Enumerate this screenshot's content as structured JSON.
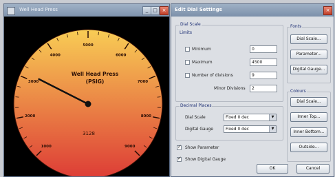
{
  "gauge_window": {
    "title": "Well Head Press",
    "minimize_glyph": "_",
    "maximize_glyph": "□",
    "close_glyph": "×"
  },
  "gauge": {
    "title_line1": "Well Head Press",
    "title_line2": "(PSIG)",
    "digital_value": "3128",
    "scale_labels": [
      "1000",
      "2000",
      "3000",
      "4000",
      "5000",
      "6000",
      "7000",
      "8000",
      "9000"
    ],
    "needle_value": 3128,
    "gradient_top": "#f8cd55",
    "gradient_bottom": "#dd3c36"
  },
  "dialog": {
    "title": "Edit Dial Settings",
    "close_glyph": "×",
    "dial_scale_group": {
      "legend": "Dial Scale",
      "sublegend": "Limits",
      "minimum_label": "Minimum",
      "minimum_value": "0",
      "maximum_label": "Maximum",
      "maximum_value": "4500",
      "num_divisions_label": "Number of divisions",
      "num_divisions_value": "9",
      "minor_divisions_label": "Minor Divisions",
      "minor_divisions_value": "2"
    },
    "decimal_group": {
      "legend": "Decimal Places",
      "dial_scale_label": "Dial Scale",
      "dial_scale_value": "Fixed 0 dec",
      "digital_gauge_label": "Digital Gauge",
      "digital_gauge_value": "Fixed 0 dec"
    },
    "show_parameter_label": "Show Parameter",
    "show_digital_gauge_label": "Show Digital Gauge",
    "fonts_group": {
      "legend": "Fonts",
      "buttons": [
        "Dial Scale...",
        "Parameter...",
        "Digital Gauge..."
      ]
    },
    "colours_group": {
      "legend": "Colours",
      "buttons": [
        "Dial Scale...",
        "Inner Top...",
        "Inner Bottom...",
        "Outside..."
      ]
    },
    "ok_label": "OK",
    "cancel_label": "Cancel"
  }
}
